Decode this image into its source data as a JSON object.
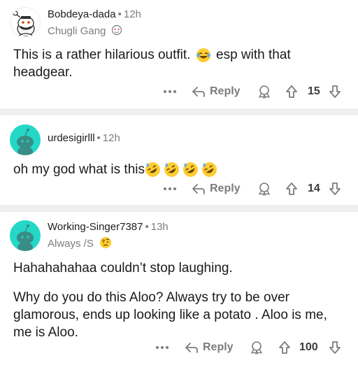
{
  "comments": [
    {
      "username": "Bobdeya-dada",
      "age": "12h",
      "flair": "Chugli Gang",
      "flair_icon": "cake-icon",
      "avatar": "custom-snoo-avatar",
      "body": "This is a rather hilarious outfit.",
      "body_after_emoji": "esp with that headgear.",
      "emoji": "joy-face-emoji",
      "votes": "15",
      "reply_label": "Reply"
    },
    {
      "username": "urdesigirlll",
      "age": "12h",
      "avatar": "default-snoo-avatar",
      "body": "oh my god what is this",
      "emoji": "rofl-face-emoji",
      "emoji_count": 4,
      "votes": "14",
      "reply_label": "Reply"
    },
    {
      "username": "Working-Singer7387",
      "age": "13h",
      "flair": "Always /S",
      "flair_icon": "raised-eyebrow-emoji",
      "avatar": "default-snoo-avatar",
      "paragraphs": [
        "Hahahahahaa couldn’t stop laughing.",
        "Why do you do this Aloo? Always try to be over glamorous, ends up looking like a potato . Aloo is me, me is Aloo."
      ],
      "votes": "100",
      "reply_label": "Reply"
    }
  ],
  "colors": {
    "separator": "#edeff1",
    "avatar_teal": "#24d8c8",
    "muted": "#7c7c7c"
  }
}
